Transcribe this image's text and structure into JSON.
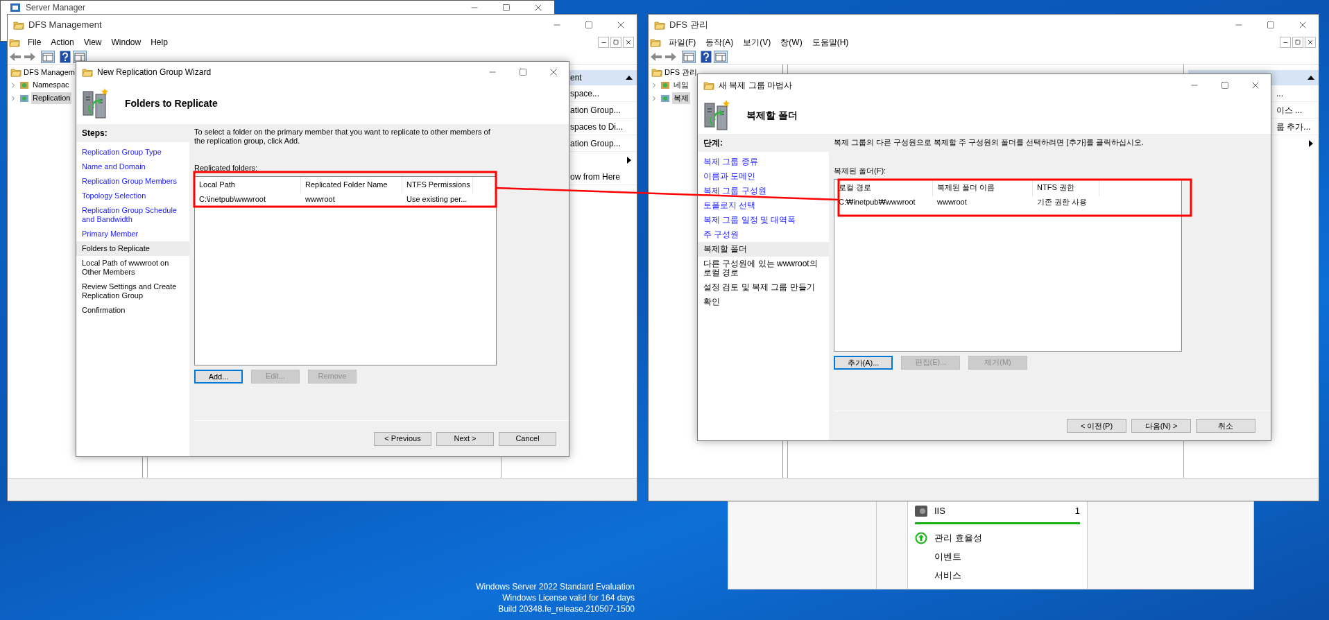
{
  "server_manager": {
    "title": "Server Manager"
  },
  "dfs_windows": [
    {
      "title": "DFS Management",
      "menu": [
        "File",
        "Action",
        "View",
        "Window",
        "Help"
      ],
      "tree": {
        "label": "DFS Managem",
        "children": [
          {
            "label": "Namespac",
            "selected": false
          },
          {
            "label": "Replication",
            "selected": true
          }
        ]
      },
      "actions": {
        "header": "ent",
        "items": [
          {
            "kind": "text",
            "label": "space..."
          },
          {
            "kind": "text",
            "label": "ation Group..."
          },
          {
            "kind": "text",
            "label": "spaces to Di..."
          },
          {
            "kind": "text",
            "label": "ation Group..."
          },
          {
            "kind": "submenu"
          },
          {
            "kind": "text",
            "label": "ow from Here"
          }
        ]
      },
      "wizard": {
        "title": "New Replication Group Wizard",
        "heading": "Folders to Replicate",
        "steps_label": "Steps:",
        "steps": [
          {
            "label": "Replication Group Type",
            "completed": true,
            "selected": false
          },
          {
            "label": "Name and Domain",
            "completed": true,
            "selected": false
          },
          {
            "label": "Replication Group Members",
            "completed": true,
            "selected": false
          },
          {
            "label": "Topology Selection",
            "completed": true,
            "selected": false
          },
          {
            "label": "Replication Group Schedule and Bandwidth",
            "completed": true,
            "selected": false
          },
          {
            "label": "Primary Member",
            "completed": true,
            "selected": false
          },
          {
            "label": "Folders to Replicate",
            "completed": false,
            "selected": true
          },
          {
            "label": "Local Path of wwwroot on Other Members",
            "completed": false,
            "selected": false
          },
          {
            "label": "Review Settings and Create Replication Group",
            "completed": false,
            "selected": false
          },
          {
            "label": "Confirmation",
            "completed": false,
            "selected": false
          }
        ],
        "instructions": "To select a folder on the primary member that you want to replicate to other members of the replication group, click Add.",
        "list_label": "Replicated folders:",
        "columns": [
          "Local Path",
          "Replicated Folder Name",
          "NTFS Permissions"
        ],
        "rows": [
          [
            "C:\\inetpub\\wwwroot",
            "wwwroot",
            "Use existing per..."
          ]
        ],
        "list_buttons": [
          {
            "label": "Add...",
            "disabled": false
          },
          {
            "label": "Edit...",
            "disabled": true
          },
          {
            "label": "Remove",
            "disabled": true
          }
        ],
        "nav_buttons": [
          "< Previous",
          "Next >",
          "Cancel"
        ]
      }
    },
    {
      "title": "DFS 관리",
      "menu": [
        "파일(F)",
        "동작(A)",
        "보기(V)",
        "창(W)",
        "도움말(H)"
      ],
      "tree": {
        "label": "DFS 관리",
        "children": [
          {
            "label": "네임",
            "selected": false
          },
          {
            "label": "복제",
            "selected": true
          }
        ]
      },
      "actions": {
        "items": [
          {
            "kind": "text",
            "label": "..."
          },
          {
            "kind": "text",
            "label": "이스 ..."
          },
          {
            "kind": "text",
            "label": "룹 추가..."
          },
          {
            "kind": "submenu"
          }
        ]
      },
      "wizard": {
        "title": "새 복제 그룹 마법사",
        "heading": "복제할 폴더",
        "steps_label": "단계:",
        "steps": [
          {
            "label": "복제 그룹 종류",
            "completed": true,
            "selected": false
          },
          {
            "label": "이름과 도메인",
            "completed": true,
            "selected": false
          },
          {
            "label": "복제 그룹 구성원",
            "completed": true,
            "selected": false
          },
          {
            "label": "토폴로지 선택",
            "completed": true,
            "selected": false
          },
          {
            "label": "복제 그룹 일정 및 대역폭",
            "completed": true,
            "selected": false
          },
          {
            "label": "주 구성원",
            "completed": true,
            "selected": false
          },
          {
            "label": "복제할 폴더",
            "completed": false,
            "selected": true
          },
          {
            "label": "다른 구성원에 있는 wwwroot의 로컬 경로",
            "completed": false,
            "selected": false
          },
          {
            "label": "설정 검토 및 복제 그룹 만들기",
            "completed": false,
            "selected": false
          },
          {
            "label": "확인",
            "completed": false,
            "selected": false
          }
        ],
        "instructions": "복제 그룹의 다른 구성원으로 복제할 주 구성원의 폴더를 선택하려면 [추가]를 클릭하십시오.",
        "list_label": "복제된 폴더(F):",
        "columns": [
          "로컬 경로",
          "복제된 폴더 이름",
          "NTFS 권한"
        ],
        "rows": [
          [
            "C:₩inetpub₩wwwroot",
            "wwwroot",
            "기존 권한 사용"
          ]
        ],
        "list_buttons": [
          {
            "label": "추가(A)...",
            "disabled": false
          },
          {
            "label": "편집(E)...",
            "disabled": true
          },
          {
            "label": "제거(M)",
            "disabled": true
          }
        ],
        "nav_buttons": [
          "< 이전(P)",
          "다음(N) >",
          "취소"
        ]
      }
    }
  ],
  "dashboard_tile": {
    "header": "IIS",
    "count": "1",
    "items": [
      {
        "kind": "status",
        "label": "관리 효율성"
      },
      {
        "kind": "plain",
        "label": "이벤트"
      },
      {
        "kind": "plain",
        "label": "서비스"
      }
    ]
  },
  "desktop_info": [
    "Windows Server 2022 Standard Evaluation",
    "Windows License valid for 164 days",
    "Build 20348.fe_release.210507-1500"
  ]
}
